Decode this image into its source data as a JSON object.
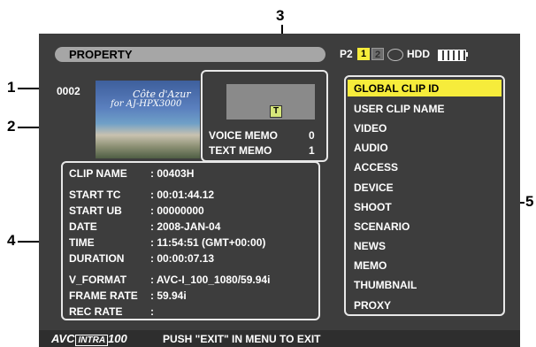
{
  "callouts": {
    "c1": "1",
    "c2": "2",
    "c3": "3",
    "c4": "4",
    "c5": "5"
  },
  "header": {
    "title": "PROPERTY",
    "media_label": "P2",
    "slot1": "1",
    "slot2": "2",
    "hdd_label": "HDD"
  },
  "clip": {
    "number": "0002",
    "thumbnail_caption_1": "Côte d'Azur",
    "thumbnail_caption_2": "for AJ-HPX3000"
  },
  "memo": {
    "icon": "T",
    "voice_label": "VOICE MEMO",
    "voice_count": "0",
    "text_label": "TEXT MEMO",
    "text_count": "1"
  },
  "info": [
    {
      "label": "CLIP NAME",
      "value": ": 00403H"
    },
    {
      "label": "START TC",
      "value": ": 00:01:44.12"
    },
    {
      "label": "START UB",
      "value": ": 00000000"
    },
    {
      "label": "DATE",
      "value": ": 2008-JAN-04"
    },
    {
      "label": "TIME",
      "value": ": 11:54:51 (GMT+00:00)"
    },
    {
      "label": "DURATION",
      "value": ": 00:00:07.13"
    },
    {
      "label": "V_FORMAT",
      "value": ": AVC-I_100_1080/59.94i"
    },
    {
      "label": "FRAME RATE",
      "value": ": 59.94i"
    },
    {
      "label": "REC RATE",
      "value": ":"
    }
  ],
  "menu": [
    "GLOBAL CLIP ID",
    "USER CLIP NAME",
    "VIDEO",
    "AUDIO",
    "ACCESS",
    "DEVICE",
    "SHOOT",
    "SCENARIO",
    "NEWS",
    "MEMO",
    "THUMBNAIL",
    "PROXY"
  ],
  "footer": {
    "logo_avc": "AVC",
    "logo_intra": "INTRA",
    "logo_num": "100",
    "message": "PUSH \"EXIT\" IN MENU TO EXIT"
  },
  "colors": {
    "highlight": "#f6ec3b",
    "screen_bg": "#3d3d3d",
    "slot_active": "#f6ec3b"
  }
}
